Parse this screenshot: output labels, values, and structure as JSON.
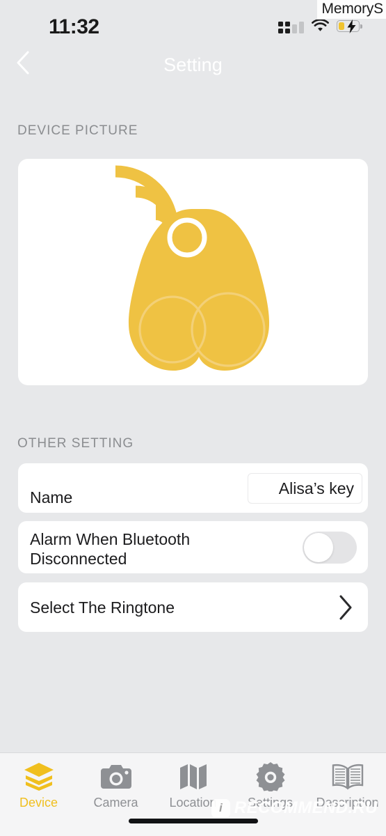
{
  "status_bar": {
    "time": "11:32",
    "signal_icon": "cellular-signal-icon",
    "wifi_icon": "wifi-icon",
    "battery_icon": "battery-charging-icon",
    "battery_level_percent": 25,
    "overlay_text": "MemoryS"
  },
  "nav": {
    "back_icon": "chevron-left-icon",
    "title": "Setting"
  },
  "sections": {
    "device_picture_label": "DEVICE PICTURE",
    "other_setting_label": "OTHER SETTING"
  },
  "device_picture": {
    "image_name": "bluetooth-tracker-illustration",
    "signal_icon": "signal-waves-icon"
  },
  "rows": {
    "name": {
      "label": "Name",
      "value": "Alisa’s key",
      "placeholder": "Name"
    },
    "alarm": {
      "label": "Alarm When Bluetooth Disconnected",
      "toggle_state": "off"
    },
    "ringtone": {
      "label": "Select The Ringtone",
      "chevron_icon": "chevron-right-icon"
    }
  },
  "tabs": [
    {
      "label": "Device",
      "icon": "layers-icon",
      "active": true
    },
    {
      "label": "Camera",
      "icon": "camera-icon",
      "active": false
    },
    {
      "label": "Location",
      "icon": "map-icon",
      "active": false
    },
    {
      "label": "Settings",
      "icon": "gear-icon",
      "active": false
    },
    {
      "label": "Description",
      "icon": "open-book-icon",
      "active": false
    }
  ],
  "watermark": {
    "badge": "i",
    "text": "RECOMMEND.RU"
  },
  "colors": {
    "background": "#e7e8ea",
    "card": "#ffffff",
    "accent_yellow": "#efc243",
    "tab_active": "#f0bf1e",
    "tab_inactive": "#8e9094",
    "label_gray": "#8b8d90",
    "text_primary": "#1c1c1e"
  }
}
